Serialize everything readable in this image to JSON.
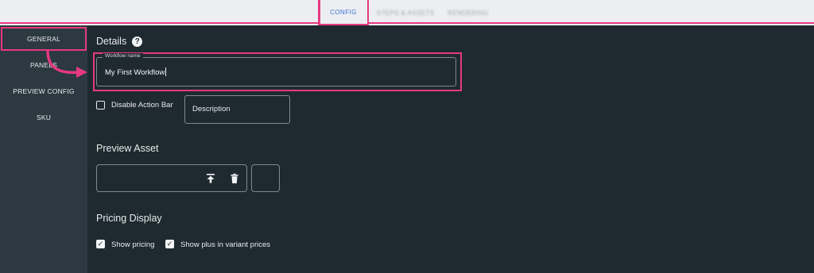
{
  "tabs": [
    {
      "label": "CONFIG",
      "active": true
    },
    {
      "label": "STEPS & ASSETS",
      "active": false
    },
    {
      "label": "RENDERING",
      "active": false
    }
  ],
  "sidebar": {
    "items": [
      {
        "label": "GENERAL",
        "active": true
      },
      {
        "label": "PANELS"
      },
      {
        "label": "PREVIEW CONFIG"
      },
      {
        "label": "SKU"
      }
    ]
  },
  "details": {
    "heading": "Details",
    "help_glyph": "?",
    "workflow_name": {
      "label": "Workflow name",
      "value": "My First Workflow"
    },
    "disable_action_bar": {
      "label": "Disable Action Bar",
      "checked": false
    },
    "description_button": "Description"
  },
  "preview_asset": {
    "heading": "Preview Asset",
    "upload_icon": "upload-icon",
    "delete_icon": "trash-icon"
  },
  "pricing_display": {
    "heading": "Pricing Display",
    "show_pricing": {
      "label": "Show pricing",
      "checked": true
    },
    "show_plus": {
      "label": "Show plus in variant prices",
      "checked": true
    }
  },
  "colors": {
    "highlight": "#e6397f",
    "accent": "#3d73d6",
    "background": "#1f2a30",
    "sidebar": "#2c3940"
  }
}
